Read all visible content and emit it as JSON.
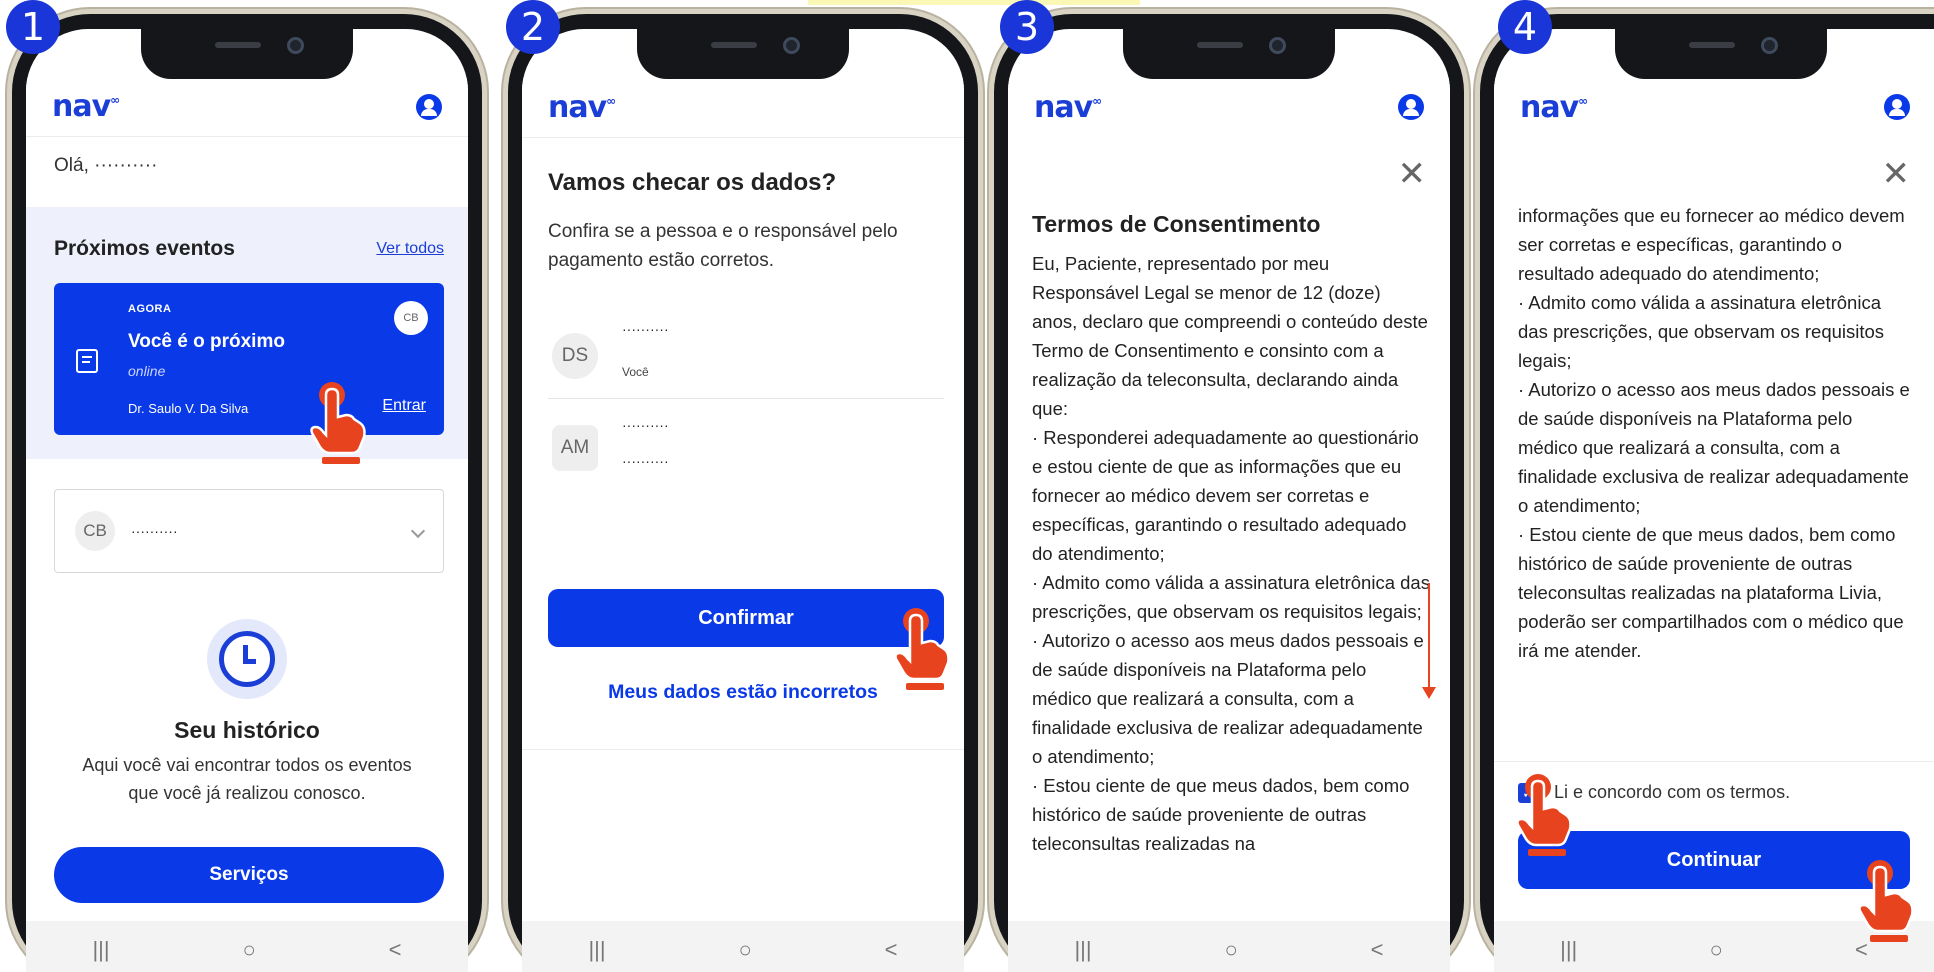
{
  "steps": [
    "1",
    "2",
    "3",
    "4"
  ],
  "brand": {
    "logo": "nav",
    "logo_mark": "∞",
    "accent": "#0a39e8"
  },
  "system_nav": {
    "recents": "|||",
    "home": "○",
    "back": "<"
  },
  "screen1": {
    "greeting": "Olá,",
    "greeting_name": "··········",
    "events_title": "Próximos eventos",
    "see_all": "Ver todos",
    "event": {
      "tag": "AGORA",
      "title": "Você é o próximo",
      "mode": "online",
      "doctor": "Dr. Saulo V. Da Silva",
      "enter": "Entrar",
      "avatar": "CB"
    },
    "select": {
      "avatar": "CB",
      "value": "··········"
    },
    "history_title": "Seu histórico",
    "history_text": "Aqui você vai encontrar todos os eventos que você já realizou conosco.",
    "services_button": "Serviços"
  },
  "screen2": {
    "title": "Vamos checar os dados?",
    "subtitle": "Confira se a pessoa e o responsável pelo pagamento estão corretos.",
    "person1": {
      "initials": "DS",
      "name": "··········",
      "role": "Você"
    },
    "person2": {
      "initials": "AM",
      "name": "··········",
      "detail": "··········"
    },
    "confirm_button": "Confirmar",
    "incorrect_link": "Meus dados estão incorretos"
  },
  "screen3": {
    "title": "Termos de Consentimento",
    "body": "Eu, Paciente, representado por meu Responsável Legal se menor de 12 (doze) anos, declaro que compreendi o conteúdo deste Termo de Consentimento e consinto com a realização da teleconsulta, declarando ainda que:\n· Responderei adequadamente ao questionário e estou ciente de que as informações que eu fornecer ao médico devem ser corretas e específicas, garantindo o resultado adequado do atendimento;\n· Admito como válida a assinatura eletrônica das prescrições, que observam os requisitos legais;\n· Autorizo o acesso aos meus dados pessoais e de saúde disponíveis na Plataforma pelo médico que realizará a consulta, com a finalidade exclusiva de realizar adequadamente o atendimento;\n· Estou ciente de que meus dados, bem como histórico de saúde proveniente de outras teleconsultas realizadas na"
  },
  "screen4": {
    "body": "informações que eu fornecer ao médico devem ser corretas e específicas, garantindo o resultado adequado do atendimento;\n· Admito como válida a assinatura eletrônica das prescrições, que observam os requisitos legais;\n· Autorizo o acesso aos meus dados pessoais e de saúde disponíveis na Plataforma pelo médico que realizará a consulta, com a finalidade exclusiva de realizar adequadamente o atendimento;\n· Estou ciente de que meus dados, bem como histórico de saúde proveniente de outras teleconsultas realizadas na plataforma Livia, poderão ser compartilhados com o médico que irá me atender.",
    "agree_label": "Li e concordo com os termos.",
    "continue_button": "Continuar"
  }
}
